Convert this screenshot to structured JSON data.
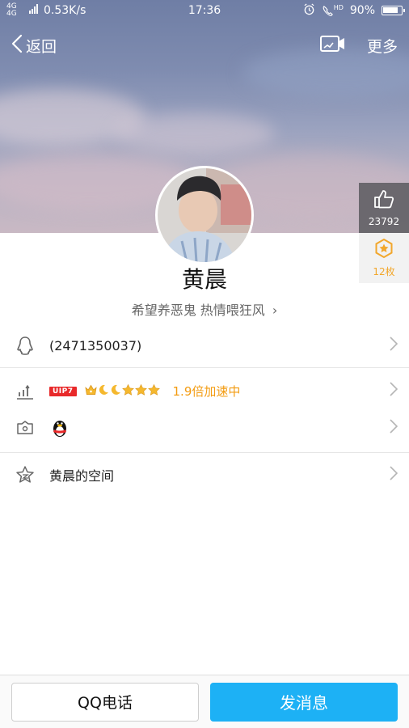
{
  "status_bar": {
    "network": "4G 4G",
    "speed": "0.53K/s",
    "time": "17:36",
    "battery": "90%",
    "battery_level": 0.9,
    "hd_label": "HD"
  },
  "nav": {
    "back_label": "返回",
    "more_label": "更多"
  },
  "side_panel": {
    "likes": "23792",
    "gifts": "12枚"
  },
  "profile": {
    "name": "黄晨",
    "signature": "希望养恶鬼 热情喂狂风",
    "signature_chevron": "›"
  },
  "rows": {
    "qq_number": "(2471350037)",
    "vip_badge": "UIP7",
    "level_icons": [
      "crown",
      "moon",
      "moon",
      "star",
      "star",
      "star"
    ],
    "accel_text": "1.9倍加速中",
    "space_label": "黄晨的空间"
  },
  "bottom": {
    "call_label": "QQ电话",
    "message_label": "发消息"
  },
  "colors": {
    "accent_blue": "#1db1f5",
    "accel_orange": "#f39c12",
    "vip_red": "#e8292a",
    "gift_gold": "#f2a72c"
  }
}
